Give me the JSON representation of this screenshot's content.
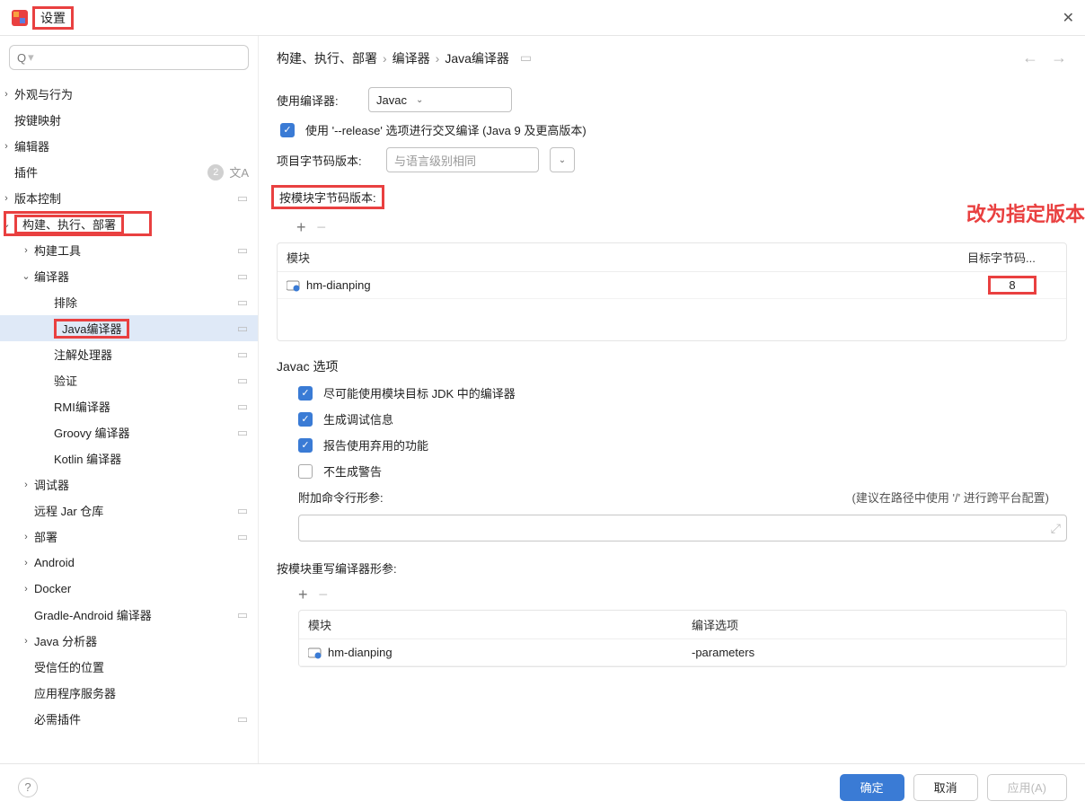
{
  "title": "设置",
  "annotation": "改为指定版本",
  "breadcrumb": [
    "构建、执行、部署",
    "编译器",
    "Java编译器"
  ],
  "sidebar": {
    "items": [
      {
        "label": "外观与行为",
        "chev": "›"
      },
      {
        "label": "按键映射"
      },
      {
        "label": "编辑器",
        "chev": "›"
      },
      {
        "label": "插件",
        "badge": "2",
        "lang": true
      },
      {
        "label": "版本控制",
        "chev": "›",
        "end": true
      },
      {
        "label": "构建、执行、部署",
        "chev": "v",
        "red": true,
        "outer": true
      },
      {
        "label": "构建工具",
        "chev": "›",
        "s": 1,
        "end": true
      },
      {
        "label": "编译器",
        "chev": "v",
        "s": 1,
        "end": true
      },
      {
        "label": "排除",
        "s": 2,
        "end": true
      },
      {
        "label": "Java编译器",
        "s": 2,
        "end": true,
        "sel": true,
        "red": true
      },
      {
        "label": "注解处理器",
        "s": 2,
        "end": true
      },
      {
        "label": "验证",
        "s": 2,
        "end": true
      },
      {
        "label": "RMI编译器",
        "s": 2,
        "end": true
      },
      {
        "label": "Groovy 编译器",
        "s": 2,
        "end": true
      },
      {
        "label": "Kotlin 编译器",
        "s": 2
      },
      {
        "label": "调试器",
        "chev": "›",
        "s": 1
      },
      {
        "label": "远程 Jar 仓库",
        "s": 1,
        "end": true
      },
      {
        "label": "部署",
        "chev": "›",
        "s": 1,
        "end": true
      },
      {
        "label": "Android",
        "chev": "›",
        "s": 1
      },
      {
        "label": "Docker",
        "chev": "›",
        "s": 1
      },
      {
        "label": "Gradle-Android 编译器",
        "s": 1,
        "end": true
      },
      {
        "label": "Java 分析器",
        "chev": "›",
        "s": 1
      },
      {
        "label": "受信任的位置",
        "s": 1
      },
      {
        "label": "应用程序服务器",
        "s": 1
      },
      {
        "label": "必需插件",
        "s": 1,
        "end": true
      }
    ]
  },
  "form": {
    "compilerLabel": "使用编译器:",
    "compilerValue": "Javac",
    "releaseOpt": "使用 '--release' 选项进行交叉编译 (Java 9 及更高版本)",
    "bytecodeLabel": "项目字节码版本:",
    "bytecodePlaceholder": "与语言级别相同",
    "perModuleLabel": "按模块字节码版本:",
    "table1": {
      "cols": [
        "模块",
        "目标字节码..."
      ],
      "rows": [
        {
          "module": "hm-dianping",
          "target": "8"
        }
      ]
    },
    "javacSection": "Javac 选项",
    "opt1": "尽可能使用模块目标 JDK 中的编译器",
    "opt2": "生成调试信息",
    "opt3": "报告使用弃用的功能",
    "opt4": "不生成警告",
    "cmdLabel": "附加命令行形参:",
    "cmdHint": "(建议在路径中使用 '/' 进行跨平台配置)",
    "overrideLabel": "按模块重写编译器形参:",
    "table2": {
      "cols": [
        "模块",
        "编译选项"
      ],
      "rows": [
        {
          "module": "hm-dianping",
          "opts": "-parameters"
        }
      ]
    }
  },
  "footer": {
    "ok": "确定",
    "cancel": "取消",
    "apply": "应用(A)"
  }
}
